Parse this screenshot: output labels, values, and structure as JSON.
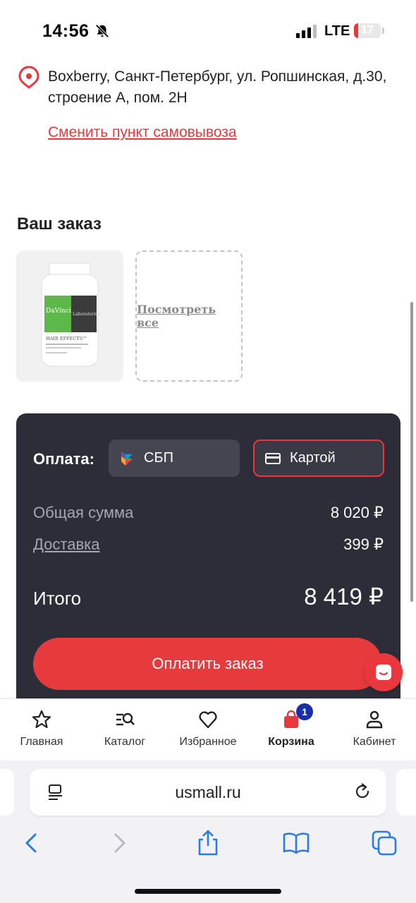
{
  "status_bar": {
    "time": "14:56",
    "network": "LTE",
    "battery": "17",
    "battery_level": 0.17
  },
  "pickup": {
    "address": "Boxberry, Санкт-Петербург, ул. Ропшинская, д.30, строение А, пом. 2Н",
    "change_link": "Сменить пункт самовывоза"
  },
  "order": {
    "title": "Ваш заказ",
    "view_all": "Посмотреть все",
    "product": {
      "brand": "DaVinci",
      "brand_suffix": "Laboratories",
      "name": "HAIR EFFECTS™"
    }
  },
  "payment": {
    "label": "Оплата:",
    "options": [
      {
        "label": "СБП",
        "selected": false
      },
      {
        "label": "Картой",
        "selected": true
      }
    ],
    "subtotal_label": "Общая сумма",
    "subtotal_value": "8 020 ₽",
    "delivery_label": "Доставка",
    "delivery_value": "399 ₽",
    "total_label": "Итого",
    "total_value": "8 419 ₽",
    "pay_button": "Оплатить заказ"
  },
  "nav": {
    "items": [
      {
        "label": "Главная",
        "icon": "star-icon"
      },
      {
        "label": "Каталог",
        "icon": "catalog-search-icon"
      },
      {
        "label": "Избранное",
        "icon": "heart-icon"
      },
      {
        "label": "Корзина",
        "icon": "bag-icon",
        "badge": "1",
        "active": true
      },
      {
        "label": "Кабинет",
        "icon": "user-icon"
      }
    ]
  },
  "browser": {
    "url": "usmall.ru"
  },
  "colors": {
    "accent": "#e8383d",
    "panel": "#2d2d3a",
    "badge": "#1a2ea8"
  }
}
